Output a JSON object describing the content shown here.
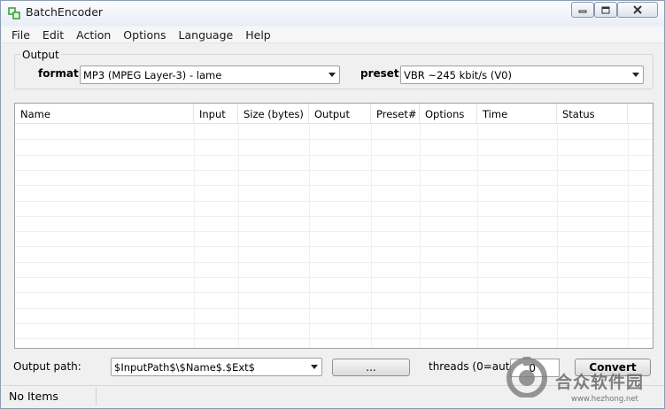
{
  "window": {
    "title": "BatchEncoder",
    "icon": "batchencoder-app-icon",
    "controls": [
      "minimize-icon",
      "maximize-icon",
      "close-icon"
    ]
  },
  "menu": [
    "File",
    "Edit",
    "Action",
    "Options",
    "Language",
    "Help"
  ],
  "output_group": {
    "label": "Output",
    "format_label": "format:",
    "format_value": "MP3 (MPEG Layer-3) - lame",
    "preset_label": "preset:",
    "preset_value": "VBR ~245 kbit/s (V0)"
  },
  "list": {
    "columns": [
      "Name",
      "Input",
      "Size (bytes)",
      "Output",
      "Preset#",
      "Options",
      "Time",
      "Status"
    ],
    "rows": []
  },
  "bottom": {
    "output_path_label": "Output path:",
    "output_path_value": "$InputPath$\\$Name$.$Ext$",
    "browse_label": "...",
    "threads_label": "threads (0=auto):",
    "threads_value": "0",
    "convert_label": "Convert"
  },
  "status": {
    "text": "No Items"
  },
  "watermark": {
    "text": "合众软件园",
    "url": "www.hezhong.net"
  },
  "colors": {
    "window_bg": "#f0f0f0",
    "title_gradient_top": "#fbfcfe",
    "border": "#a0a0a0",
    "icon_green": "#3aa53a"
  }
}
